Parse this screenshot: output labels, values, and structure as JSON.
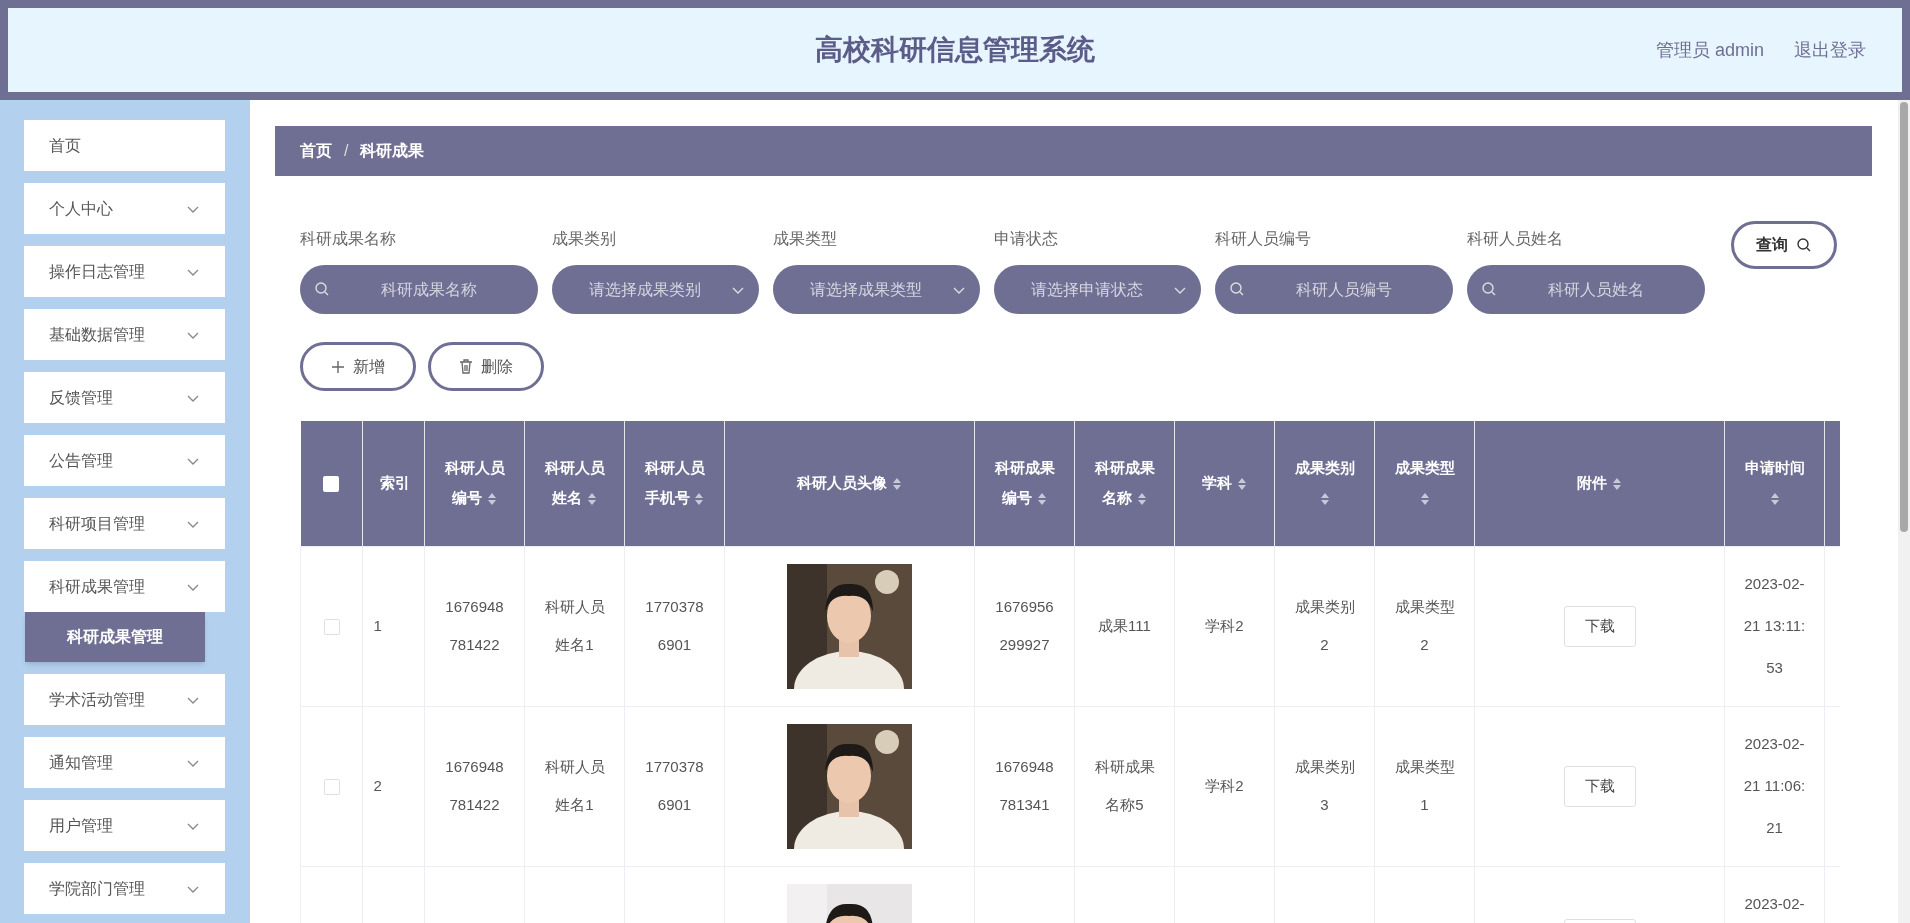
{
  "header": {
    "title": "高校科研信息管理系统",
    "user": "管理员 admin",
    "logout": "退出登录"
  },
  "sidebar": {
    "items": [
      {
        "label": "首页",
        "kind": "link"
      },
      {
        "label": "个人中心",
        "kind": "group"
      },
      {
        "label": "操作日志管理",
        "kind": "group"
      },
      {
        "label": "基础数据管理",
        "kind": "group"
      },
      {
        "label": "反馈管理",
        "kind": "group"
      },
      {
        "label": "公告管理",
        "kind": "group"
      },
      {
        "label": "科研项目管理",
        "kind": "group"
      },
      {
        "label": "科研成果管理",
        "kind": "group",
        "children": [
          {
            "label": "科研成果管理",
            "selected": true
          }
        ]
      },
      {
        "label": "学术活动管理",
        "kind": "group"
      },
      {
        "label": "通知管理",
        "kind": "group"
      },
      {
        "label": "用户管理",
        "kind": "group"
      },
      {
        "label": "学院部门管理",
        "kind": "group"
      }
    ]
  },
  "breadcrumb": [
    "首页",
    "科研成果"
  ],
  "breadcrumb_separator": "/",
  "filters": [
    {
      "label": "科研成果名称",
      "kind": "search",
      "placeholder": "科研成果名称"
    },
    {
      "label": "成果类别",
      "kind": "select",
      "placeholder": "请选择成果类别"
    },
    {
      "label": "成果类型",
      "kind": "select",
      "placeholder": "请选择成果类型"
    },
    {
      "label": "申请状态",
      "kind": "select",
      "placeholder": "请选择申请状态"
    },
    {
      "label": "科研人员编号",
      "kind": "search",
      "placeholder": "科研人员编号"
    },
    {
      "label": "科研人员姓名",
      "kind": "search",
      "placeholder": "科研人员姓名"
    }
  ],
  "query_button": "查询",
  "actions": [
    {
      "label": "新增",
      "kind": "add"
    },
    {
      "label": "删除",
      "kind": "delete"
    }
  ],
  "table": {
    "select_all": {
      "checked": false
    },
    "columns": [
      {
        "label": "索引",
        "sortable": false
      },
      {
        "label": "科研人员编号",
        "sortable": true
      },
      {
        "label": "科研人员姓名",
        "sortable": true
      },
      {
        "label": "科研人员手机号",
        "sortable": true
      },
      {
        "label": "科研人员头像",
        "sortable": true
      },
      {
        "label": "科研成果编号",
        "sortable": true
      },
      {
        "label": "科研成果名称",
        "sortable": true
      },
      {
        "label": "学科",
        "sortable": true
      },
      {
        "label": "成果类别",
        "sortable": true
      },
      {
        "label": "成果类型",
        "sortable": true
      },
      {
        "label": "附件",
        "sortable": true
      },
      {
        "label": "申请时间",
        "sortable": true
      }
    ],
    "rows": [
      {
        "checked": false,
        "cells": [
          {
            "kind": "text",
            "text": "1"
          },
          {
            "kind": "text",
            "text": "1676948781422"
          },
          {
            "kind": "text",
            "text": "科研人员姓名1"
          },
          {
            "kind": "text",
            "text": "17703786901"
          },
          {
            "kind": "picture"
          },
          {
            "kind": "text",
            "text": "1676956299927"
          },
          {
            "kind": "text",
            "text": "成果111"
          },
          {
            "kind": "text",
            "text": "学科2"
          },
          {
            "kind": "text",
            "text": "成果类别2"
          },
          {
            "kind": "text",
            "text": "成果类型2"
          },
          {
            "kind": "button",
            "text": "下载"
          },
          {
            "kind": "text",
            "text": "2023-02-21 13:11:53"
          }
        ]
      },
      {
        "checked": false,
        "cells": [
          {
            "kind": "text",
            "text": "2"
          },
          {
            "kind": "text",
            "text": "1676948781422"
          },
          {
            "kind": "text",
            "text": "科研人员姓名1"
          },
          {
            "kind": "text",
            "text": "17703786901"
          },
          {
            "kind": "picture"
          },
          {
            "kind": "text",
            "text": "1676948781341"
          },
          {
            "kind": "text",
            "text": "科研成果名称5"
          },
          {
            "kind": "text",
            "text": "学科2"
          },
          {
            "kind": "text",
            "text": "成果类别3"
          },
          {
            "kind": "text",
            "text": "成果类型1"
          },
          {
            "kind": "button",
            "text": "下载"
          },
          {
            "kind": "text",
            "text": "2023-02-21 11:06:21"
          }
        ]
      },
      {
        "cells": [
          {
            "kind": "empty"
          },
          {
            "kind": "empty"
          },
          {
            "kind": "empty"
          },
          {
            "kind": "empty"
          },
          {
            "kind": "picture"
          },
          {
            "kind": "empty"
          },
          {
            "kind": "empty"
          },
          {
            "kind": "empty"
          },
          {
            "kind": "empty"
          },
          {
            "kind": "empty"
          },
          {
            "kind": "button"
          },
          {
            "kind": "text",
            "text": "2023-02-"
          }
        ]
      }
    ]
  }
}
